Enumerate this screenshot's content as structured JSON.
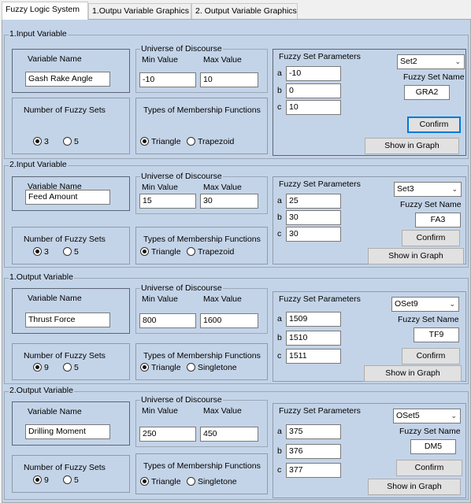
{
  "tabs": [
    "Fuzzy Logic System",
    "1.Outpu Variable Graphics",
    "2. Output Variable Graphics"
  ],
  "labels": {
    "variable_name": "Variable Name",
    "universe": "Universe of Discourse",
    "min_value": "Min Value",
    "max_value": "Max Value",
    "fuzzy_set_parameters": "Fuzzy Set Parameters",
    "fuzzy_set_name": "Fuzzy Set Name",
    "number_of_sets": "Number of Fuzzy Sets",
    "types_of_mf": "Types of Membership Functions",
    "param_a": "a",
    "param_b": "b",
    "param_c": "c",
    "confirm": "Confirm",
    "show_in_graph": "Show in Graph"
  },
  "sections": [
    {
      "title": "1.Input Variable",
      "variable_name": "Gash Rake Angle",
      "min": "-10",
      "max": "10",
      "set_select": "Set2",
      "a": "-10",
      "b": "0",
      "c": "10",
      "set_name": "GRA2",
      "num_options": [
        "3",
        "5"
      ],
      "num_selected": "3",
      "mf_options": [
        "Triangle",
        "Trapezoid"
      ],
      "mf_selected": "Triangle"
    },
    {
      "title": "2.Input Variable",
      "variable_name": "Feed Amount",
      "min": "15",
      "max": "30",
      "set_select": "Set3",
      "a": "25",
      "b": "30",
      "c": "30",
      "set_name": "FA3",
      "num_options": [
        "3",
        "5"
      ],
      "num_selected": "3",
      "mf_options": [
        "Triangle",
        "Trapezoid"
      ],
      "mf_selected": "Triangle"
    },
    {
      "title": "1.Output Variable",
      "variable_name": "Thrust Force",
      "min": "800",
      "max": "1600",
      "set_select": "OSet9",
      "a": "1509",
      "b": "1510",
      "c": "1511",
      "set_name": "TF9",
      "num_options": [
        "9",
        "5"
      ],
      "num_selected": "9",
      "mf_options": [
        "Triangle",
        "Singletone"
      ],
      "mf_selected": "Triangle"
    },
    {
      "title": "2.Output Variable",
      "variable_name": "Drilling Moment",
      "min": "250",
      "max": "450",
      "set_select": "OSet5",
      "a": "375",
      "b": "376",
      "c": "377",
      "set_name": "DM5",
      "num_options": [
        "9",
        "5"
      ],
      "num_selected": "9",
      "mf_options": [
        "Triangle",
        "Singletone"
      ],
      "mf_selected": "Triangle"
    }
  ]
}
